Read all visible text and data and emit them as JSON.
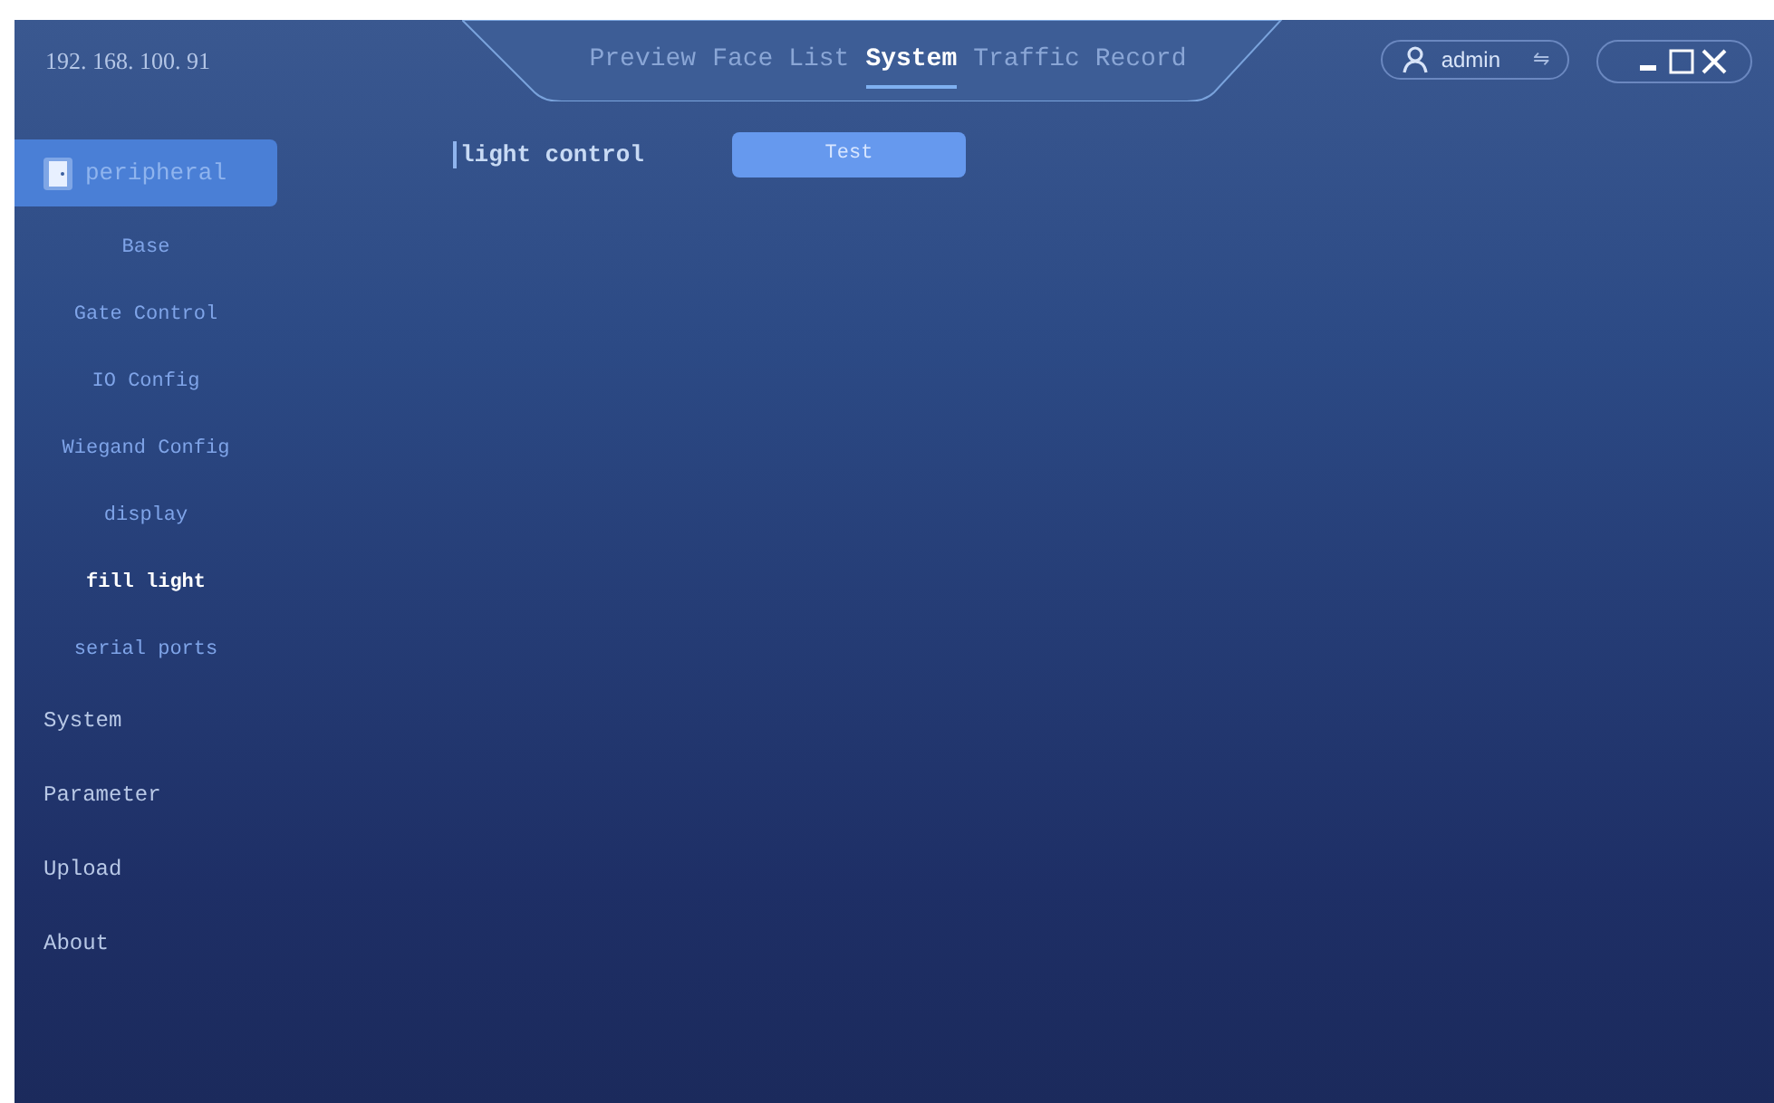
{
  "header": {
    "address": "192. 168. 100. 91",
    "tabs": [
      {
        "label": "Preview",
        "selected": false
      },
      {
        "label": "Face List",
        "selected": false
      },
      {
        "label": "System",
        "selected": true
      },
      {
        "label": "Traffic Record",
        "selected": false
      }
    ],
    "user": {
      "name": "admin",
      "switch_icon": "⇋"
    }
  },
  "sidebar": {
    "items": [
      {
        "label": "peripheral",
        "selected": true,
        "children": [
          {
            "label": "Base",
            "selected": false
          },
          {
            "label": "Gate Control",
            "selected": false
          },
          {
            "label": "IO Config",
            "selected": false
          },
          {
            "label": "Wiegand Config",
            "selected": false
          },
          {
            "label": "display",
            "selected": false
          },
          {
            "label": "fill light",
            "selected": true
          },
          {
            "label": "serial ports",
            "selected": false
          }
        ]
      },
      {
        "label": "System",
        "selected": false
      },
      {
        "label": "Parameter",
        "selected": false
      },
      {
        "label": "Upload",
        "selected": false
      },
      {
        "label": "About",
        "selected": false
      }
    ]
  },
  "content": {
    "section_title": "light control",
    "button": "Test"
  }
}
